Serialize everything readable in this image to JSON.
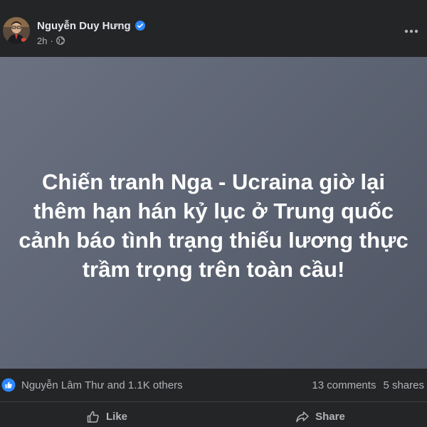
{
  "post": {
    "author": {
      "name": "Nguyễn Duy Hưng",
      "verified_icon": "verified-badge-icon",
      "avatar_icon": "avatar"
    },
    "time": "2h",
    "separator": "·",
    "audience_icon": "globe-icon",
    "more_icon": "more-options-icon",
    "content": {
      "lines": [
        "Chiến tranh Nga - Ucraina giờ lại",
        "thêm hạn hán kỷ lục ở Trung quốc",
        "cảnh báo tình trạng thiếu lương thực",
        "trầm trọng trên toàn cầu!"
      ]
    },
    "reactions": {
      "icon": "like-reaction-icon",
      "summary": "Nguyễn Lâm Thư and 1.1K others",
      "comments": "13 comments",
      "shares": "5 shares"
    },
    "actions": {
      "like_label": "Like",
      "share_label": "Share"
    }
  },
  "colors": {
    "background": "#242526",
    "text_primary": "#e4e6eb",
    "text_secondary": "#b0b3b8",
    "accent": "#2d88ff",
    "card_background": "#5e6574"
  }
}
